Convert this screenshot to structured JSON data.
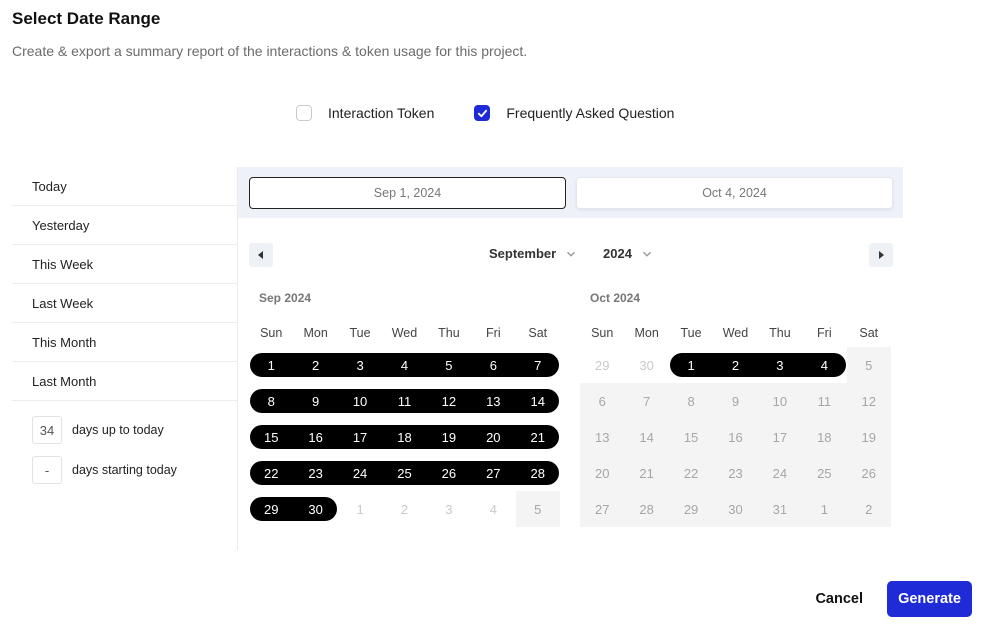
{
  "header": {
    "title": "Select Date Range",
    "subtitle": "Create & export a summary report of the interactions & token usage for this project."
  },
  "filters": [
    {
      "label": "Interaction Token",
      "checked": false
    },
    {
      "label": "Frequently Asked Question",
      "checked": true
    }
  ],
  "presets": [
    "Today",
    "Yesterday",
    "This Week",
    "Last Week",
    "This Month",
    "Last Month"
  ],
  "days_up_to_today": {
    "value": "34",
    "label": "days up to today"
  },
  "days_starting_today": {
    "value": "-",
    "label": "days starting today"
  },
  "range": {
    "start": "Sep 1, 2024",
    "end": "Oct 4, 2024"
  },
  "nav": {
    "month": "September",
    "year": "2024"
  },
  "weekdays": [
    "Sun",
    "Mon",
    "Tue",
    "Wed",
    "Thu",
    "Fri",
    "Sat"
  ],
  "months": [
    {
      "title": "Sep 2024",
      "weeks": [
        [
          [
            "1",
            "in"
          ],
          [
            "2",
            "in"
          ],
          [
            "3",
            "in"
          ],
          [
            "4",
            "in"
          ],
          [
            "5",
            "in"
          ],
          [
            "6",
            "in"
          ],
          [
            "7",
            "in"
          ]
        ],
        [
          [
            "8",
            "in"
          ],
          [
            "9",
            "in"
          ],
          [
            "10",
            "in"
          ],
          [
            "11",
            "in"
          ],
          [
            "12",
            "in"
          ],
          [
            "13",
            "in"
          ],
          [
            "14",
            "in"
          ]
        ],
        [
          [
            "15",
            "in"
          ],
          [
            "16",
            "in"
          ],
          [
            "17",
            "in"
          ],
          [
            "18",
            "in"
          ],
          [
            "19",
            "in"
          ],
          [
            "20",
            "in"
          ],
          [
            "21",
            "in"
          ]
        ],
        [
          [
            "22",
            "in"
          ],
          [
            "23",
            "in"
          ],
          [
            "24",
            "in"
          ],
          [
            "25",
            "in"
          ],
          [
            "26",
            "in"
          ],
          [
            "27",
            "in"
          ],
          [
            "28",
            "in"
          ]
        ],
        [
          [
            "29",
            "in"
          ],
          [
            "30",
            "in"
          ],
          [
            "1",
            "fade"
          ],
          [
            "2",
            "fade"
          ],
          [
            "3",
            "fade"
          ],
          [
            "4",
            "fade"
          ],
          [
            "5",
            "dis"
          ]
        ]
      ]
    },
    {
      "title": "Oct 2024",
      "weeks": [
        [
          [
            "29",
            "fade"
          ],
          [
            "30",
            "fade"
          ],
          [
            "1",
            "in"
          ],
          [
            "2",
            "in"
          ],
          [
            "3",
            "in"
          ],
          [
            "4",
            "in"
          ],
          [
            "5",
            "dis"
          ]
        ],
        [
          [
            "6",
            "dis"
          ],
          [
            "7",
            "dis"
          ],
          [
            "8",
            "dis"
          ],
          [
            "9",
            "dis"
          ],
          [
            "10",
            "dis"
          ],
          [
            "11",
            "dis"
          ],
          [
            "12",
            "dis"
          ]
        ],
        [
          [
            "13",
            "dis"
          ],
          [
            "14",
            "dis"
          ],
          [
            "15",
            "dis"
          ],
          [
            "16",
            "dis"
          ],
          [
            "17",
            "dis"
          ],
          [
            "18",
            "dis"
          ],
          [
            "19",
            "dis"
          ]
        ],
        [
          [
            "20",
            "dis"
          ],
          [
            "21",
            "dis"
          ],
          [
            "22",
            "dis"
          ],
          [
            "23",
            "dis"
          ],
          [
            "24",
            "dis"
          ],
          [
            "25",
            "dis"
          ],
          [
            "26",
            "dis"
          ]
        ],
        [
          [
            "27",
            "dis"
          ],
          [
            "28",
            "dis"
          ],
          [
            "29",
            "dis"
          ],
          [
            "30",
            "dis"
          ],
          [
            "31",
            "dis"
          ],
          [
            "1",
            "dis"
          ],
          [
            "2",
            "dis"
          ]
        ]
      ]
    }
  ],
  "actions": {
    "cancel": "Cancel",
    "generate": "Generate"
  },
  "colors": {
    "accent": "#1e2bd7",
    "range_fill": "#000000",
    "disabled_bg": "#f4f4f4",
    "range_bar_bg": "#eef2f8"
  },
  "icons": {
    "prev": "caret-left-icon",
    "next": "caret-right-icon",
    "dropdown": "chevron-down-icon",
    "check": "check-icon"
  }
}
